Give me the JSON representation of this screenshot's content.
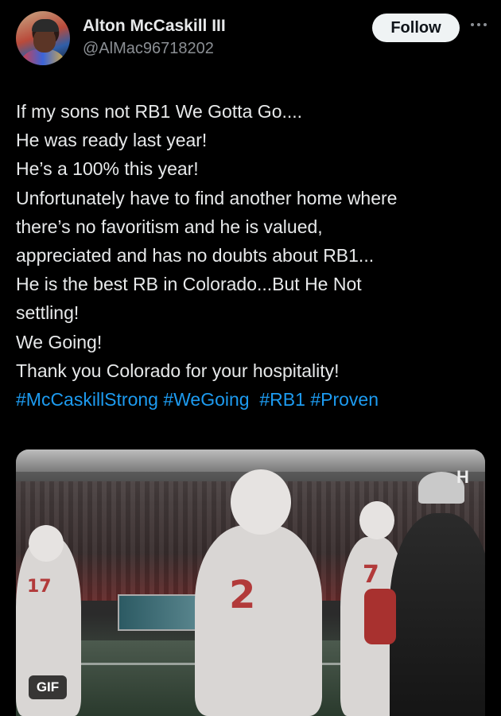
{
  "author": {
    "display_name": "Alton McCaskill III",
    "handle": "@AlMac96718202"
  },
  "follow_label": "Follow",
  "tweet": {
    "lines": [
      "If my sons not RB1 We Gotta Go....",
      "He was ready last year!",
      "He’s a 100% this year!",
      "Unfortunately have to find another home where",
      "there’s no favoritism and he is valued,",
      "appreciated and has no doubts about RB1...",
      "He is the best RB in Colorado...But He Not",
      "settling!",
      "We Going!",
      "Thank you Colorado for your hospitality!"
    ],
    "hashtags": [
      "#McCaskillStrong",
      "#WeGoing",
      "#RB1",
      "#Proven"
    ]
  },
  "media": {
    "badge": "GIF",
    "jersey_numbers": [
      "17",
      "2",
      "7"
    ]
  },
  "colors": {
    "background": "#000000",
    "text": "#e7e9ea",
    "secondary_text": "#8b8f94",
    "hashtag": "#1d9bf0",
    "follow_bg": "#eff3f4"
  },
  "icons": [
    "more-icon"
  ]
}
